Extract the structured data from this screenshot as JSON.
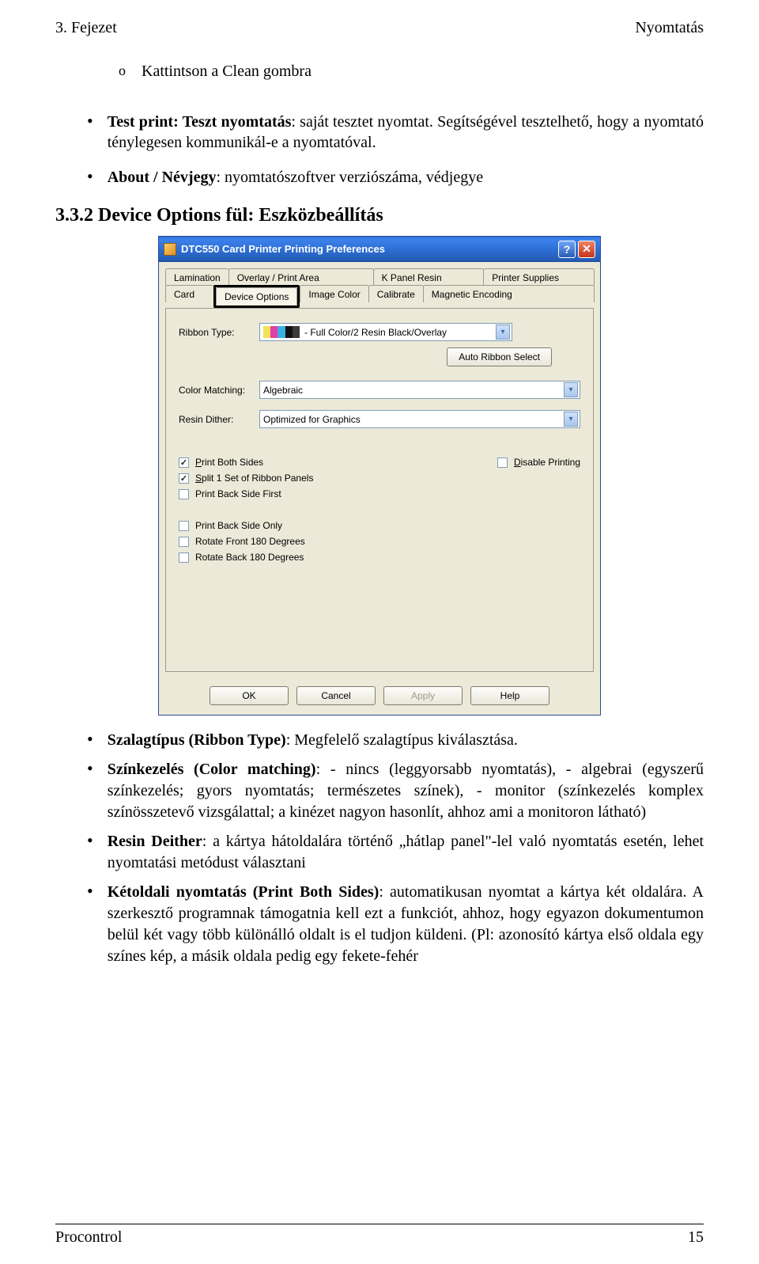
{
  "header": {
    "left": "3. Fejezet",
    "right": "Nyomtatás"
  },
  "intro": {
    "sub_bullet_marker": "o",
    "sub_bullet_text": "Kattintson a Clean gombra",
    "item1_label": "Test print: Teszt nyomtatás",
    "item1_rest": ": saját tesztet nyomtat. Segítségével tesztelhető, hogy a nyomtató ténylegesen kommunikál-e a nyomtatóval.",
    "item2_label": "About / Névjegy",
    "item2_rest": ": nyomtatószoftver verziószáma, védjegye"
  },
  "section_heading": "3.3.2 Device Options fül: Eszközbeállítás",
  "screenshot": {
    "title": "DTC550 Card Printer Printing Preferences",
    "help_btn": "?",
    "close_btn": "✕",
    "tabs_row1": [
      "Lamination",
      "Overlay / Print Area",
      "K Panel Resin",
      "Printer Supplies"
    ],
    "tabs_row2": [
      "Card",
      "Device Options",
      "Image Color",
      "Calibrate",
      "Magnetic Encoding"
    ],
    "ribbon_label": "Ribbon Type:",
    "ribbon_value": " - Full Color/2 Resin Black/Overlay",
    "ribbon_prefix_colors": [
      "#f6e15a",
      "#e03fa7",
      "#3bb0e3",
      "#111",
      "#111"
    ],
    "ribbon_prefix_text": "YMCKOK",
    "auto_ribbon_btn": "Auto Ribbon Select",
    "color_matching_label": "Color Matching:",
    "color_matching_value": "Algebraic",
    "resin_dither_label": "Resin Dither:",
    "resin_dither_value": "Optimized for Graphics",
    "checks_left": [
      {
        "label": "Print Both Sides",
        "underline_first": true,
        "checked": true
      },
      {
        "label": "Split 1 Set of Ribbon Panels",
        "underline_first": true,
        "checked": true
      },
      {
        "label": "Print Back Side First",
        "underline_first": false,
        "checked": false
      }
    ],
    "check_disable": {
      "label": "Disable Printing",
      "underline_first": true,
      "checked": false
    },
    "checks_lower": [
      {
        "label": "Print Back Side Only",
        "checked": false
      },
      {
        "label": "Rotate Front 180 Degrees",
        "checked": false
      },
      {
        "label": "Rotate Back 180 Degrees",
        "checked": false
      }
    ],
    "buttons": {
      "ok": "OK",
      "cancel": "Cancel",
      "apply": "Apply",
      "help": "Help"
    }
  },
  "body": {
    "b1_label": "Szalagtípus (Ribbon Type)",
    "b1_rest": ": Megfelelő szalagtípus kiválasztása.",
    "b2_label": "Színkezelés (Color matching)",
    "b2_rest": ": - nincs (leggyorsabb nyomtatás), - algebrai (egyszerű színkezelés; gyors nyomtatás; természetes színek), - monitor (színkezelés komplex színösszetevő vizsgálattal; a kinézet nagyon hasonlít, ahhoz ami a monitoron látható)",
    "b3_label": "Resin Deither",
    "b3_rest": ": a kártya hátoldalára történő „hátlap panel\"-lel való nyomtatás esetén, lehet nyomtatási metódust választani",
    "b4_label": "Kétoldali nyomtatás (Print Both Sides)",
    "b4_rest": ": automatikusan nyomtat a kártya két oldalára. A szerkesztő programnak támogatnia kell ezt a funkciót, ahhoz, hogy egyazon dokumentumon belül két vagy több különálló oldalt is el tudjon küldeni. (Pl: azonosító kártya első oldala egy színes kép, a másik oldala pedig egy fekete-fehér"
  },
  "footer": {
    "left": "Procontrol",
    "right": "15"
  }
}
